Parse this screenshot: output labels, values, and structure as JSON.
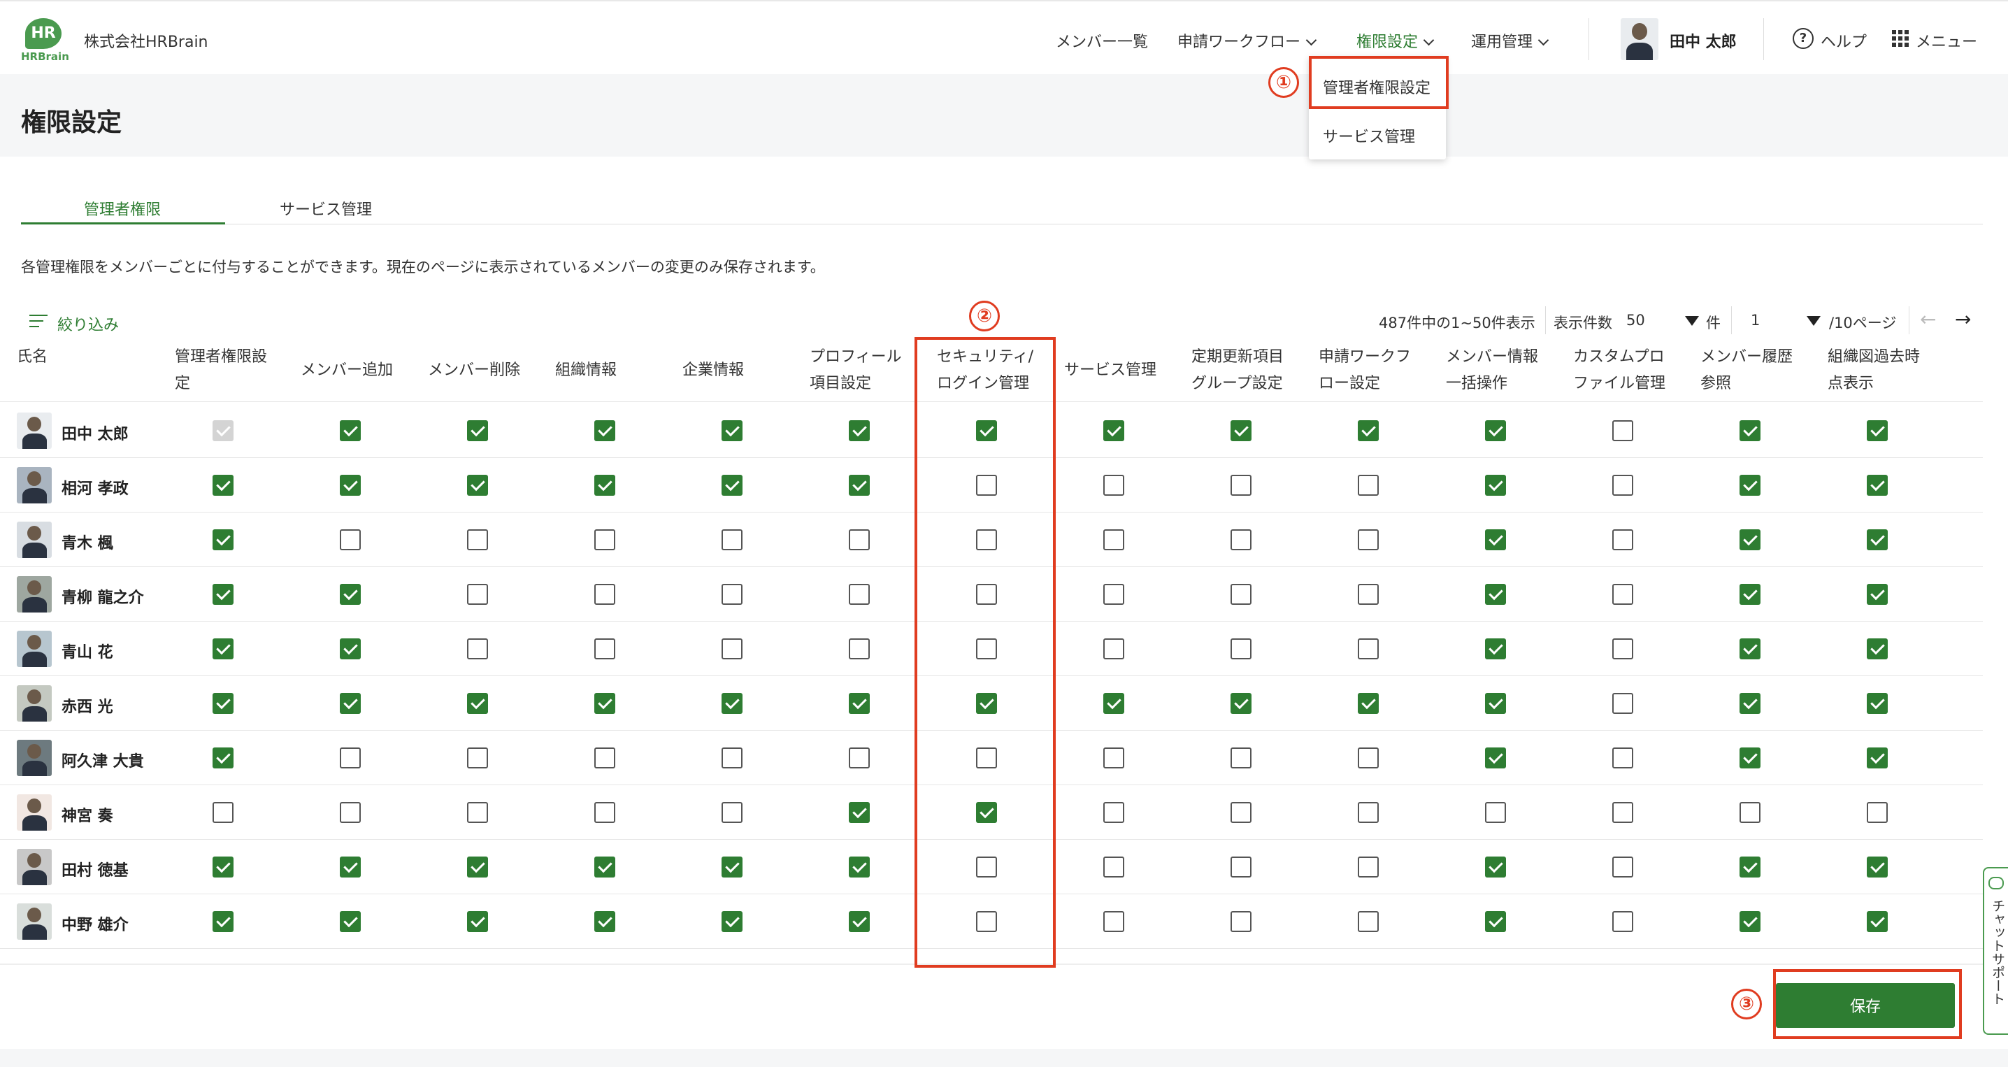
{
  "header": {
    "logo_text": "HR",
    "logo_sub": "HRBrain",
    "company": "株式会社HRBrain",
    "nav": [
      {
        "label": "メンバー一覧"
      },
      {
        "label": "申請ワークフロー"
      },
      {
        "label": "権限設定"
      },
      {
        "label": "運用管理"
      }
    ],
    "user_name": "田中 太郎",
    "help_label": "ヘルプ",
    "menu_label": "メニュー"
  },
  "dropdown": {
    "items": [
      "管理者権限設定",
      "サービス管理"
    ]
  },
  "page": {
    "title": "権限設定",
    "tabs": [
      "管理者権限",
      "サービス管理"
    ],
    "description": "各管理権限をメンバーごとに付与することができます。現在のページに表示されているメンバーの変更のみ保存されます。",
    "filter_label": "絞り込み"
  },
  "pager": {
    "summary": "487件中の1~50件表示",
    "per_page_label": "表示件数",
    "per_page": "50",
    "per_page_unit": "件",
    "page": "1",
    "total_pages": "/10ページ"
  },
  "table": {
    "name_header": "氏名",
    "columns": [
      [
        "管理者権限設",
        "定"
      ],
      [
        "メンバー追加"
      ],
      [
        "メンバー削除"
      ],
      [
        "組織情報"
      ],
      [
        "企業情報"
      ],
      [
        "プロフィール",
        "項目設定"
      ],
      [
        "セキュリティ/",
        "ログイン管理"
      ],
      [
        "サービス管理"
      ],
      [
        "定期更新項目",
        "グループ設定"
      ],
      [
        "申請ワークフ",
        "ロー設定"
      ],
      [
        "メンバー情報",
        "一括操作"
      ],
      [
        "カスタムプロ",
        "ファイル管理"
      ],
      [
        "メンバー履歴",
        "参照"
      ],
      [
        "組織図過去時",
        "点表示"
      ]
    ],
    "rows": [
      {
        "name": "田中 太郎",
        "checks": [
          "d",
          "1",
          "1",
          "1",
          "1",
          "1",
          "1",
          "1",
          "1",
          "1",
          "1",
          "0",
          "1",
          "1"
        ]
      },
      {
        "name": "相河 孝政",
        "checks": [
          "1",
          "1",
          "1",
          "1",
          "1",
          "1",
          "0",
          "0",
          "0",
          "0",
          "1",
          "0",
          "1",
          "1"
        ]
      },
      {
        "name": "青木 楓",
        "checks": [
          "1",
          "0",
          "0",
          "0",
          "0",
          "0",
          "0",
          "0",
          "0",
          "0",
          "1",
          "0",
          "1",
          "1"
        ]
      },
      {
        "name": "青柳 龍之介",
        "checks": [
          "1",
          "1",
          "0",
          "0",
          "0",
          "0",
          "0",
          "0",
          "0",
          "0",
          "1",
          "0",
          "1",
          "1"
        ]
      },
      {
        "name": "青山 花",
        "checks": [
          "1",
          "1",
          "0",
          "0",
          "0",
          "0",
          "0",
          "0",
          "0",
          "0",
          "1",
          "0",
          "1",
          "1"
        ]
      },
      {
        "name": "赤西 光",
        "checks": [
          "1",
          "1",
          "1",
          "1",
          "1",
          "1",
          "1",
          "1",
          "1",
          "1",
          "1",
          "0",
          "1",
          "1"
        ]
      },
      {
        "name": "阿久津 大貴",
        "checks": [
          "1",
          "0",
          "0",
          "0",
          "0",
          "0",
          "0",
          "0",
          "0",
          "0",
          "1",
          "0",
          "1",
          "1"
        ]
      },
      {
        "name": "神宮 奏",
        "checks": [
          "0",
          "0",
          "0",
          "0",
          "0",
          "1",
          "1",
          "0",
          "0",
          "0",
          "0",
          "0",
          "0",
          "0"
        ]
      },
      {
        "name": "田村 徳基",
        "checks": [
          "1",
          "1",
          "1",
          "1",
          "1",
          "1",
          "0",
          "0",
          "0",
          "0",
          "1",
          "0",
          "1",
          "1"
        ]
      },
      {
        "name": "中野 雄介",
        "checks": [
          "1",
          "1",
          "1",
          "1",
          "1",
          "1",
          "0",
          "0",
          "0",
          "0",
          "1",
          "0",
          "1",
          "1"
        ]
      }
    ]
  },
  "annotations": [
    "①",
    "②",
    "③"
  ],
  "footer": {
    "save_label": "保存"
  },
  "chat_support_label": "チャットサポート",
  "colors": {
    "accent": "#2e7d32",
    "highlight": "#e03c20"
  }
}
